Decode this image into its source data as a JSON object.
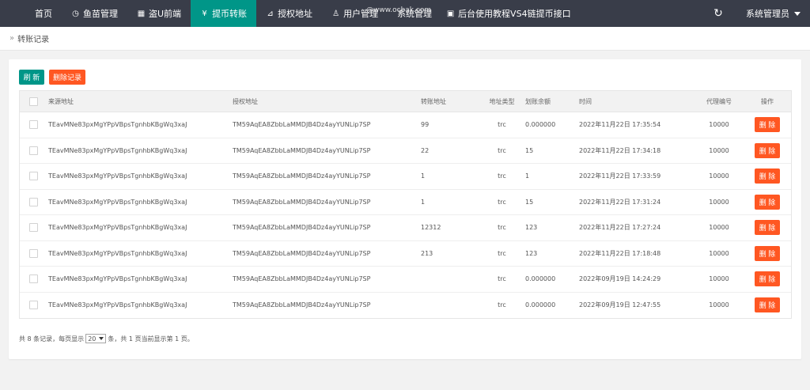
{
  "nav": {
    "home": "首页",
    "items": [
      {
        "label": "鱼苗管理",
        "icon": "clock-icon"
      },
      {
        "label": "盗U前端",
        "icon": "windows-icon"
      },
      {
        "label": "提币转账",
        "icon": "yen-circle-icon"
      },
      {
        "label": "授权地址",
        "icon": "rss-icon"
      },
      {
        "label": "用户管理",
        "icon": "user-icon"
      },
      {
        "label": "系统管理",
        "icon": ""
      },
      {
        "label": "后台使用教程VS4链提币接口",
        "icon": "book-icon"
      }
    ],
    "watermark": "@www.ocbak.com",
    "admin": "系统管理员"
  },
  "breadcrumb": {
    "current": "转账记录"
  },
  "toolbar": {
    "refresh": "刷 新",
    "delete_records": "删除记录"
  },
  "table": {
    "headers": [
      "来源地址",
      "授权地址",
      "转账地址",
      "地址类型",
      "划账余额",
      "时间",
      "代理编号",
      "操作"
    ],
    "delete_label": "删 除",
    "rows": [
      {
        "src": "TEavMNe83pxMgYPpVBpsTgnhbKBgWq3xaJ",
        "auth": "TM59AqEA8ZbbLaMMDJB4Dz4ayYUNLip7SP",
        "addr": "99",
        "type": "trc",
        "bal": "0.000000",
        "time": "2022年11月22日 17:35:54",
        "agent": "10000"
      },
      {
        "src": "TEavMNe83pxMgYPpVBpsTgnhbKBgWq3xaJ",
        "auth": "TM59AqEA8ZbbLaMMDJB4Dz4ayYUNLip7SP",
        "addr": "22",
        "type": "trc",
        "bal": "15",
        "time": "2022年11月22日 17:34:18",
        "agent": "10000"
      },
      {
        "src": "TEavMNe83pxMgYPpVBpsTgnhbKBgWq3xaJ",
        "auth": "TM59AqEA8ZbbLaMMDJB4Dz4ayYUNLip7SP",
        "addr": "1",
        "type": "trc",
        "bal": "1",
        "time": "2022年11月22日 17:33:59",
        "agent": "10000"
      },
      {
        "src": "TEavMNe83pxMgYPpVBpsTgnhbKBgWq3xaJ",
        "auth": "TM59AqEA8ZbbLaMMDJB4Dz4ayYUNLip7SP",
        "addr": "1",
        "type": "trc",
        "bal": "15",
        "time": "2022年11月22日 17:31:24",
        "agent": "10000"
      },
      {
        "src": "TEavMNe83pxMgYPpVBpsTgnhbKBgWq3xaJ",
        "auth": "TM59AqEA8ZbbLaMMDJB4Dz4ayYUNLip7SP",
        "addr": "12312",
        "type": "trc",
        "bal": "123",
        "time": "2022年11月22日 17:27:24",
        "agent": "10000"
      },
      {
        "src": "TEavMNe83pxMgYPpVBpsTgnhbKBgWq3xaJ",
        "auth": "TM59AqEA8ZbbLaMMDJB4Dz4ayYUNLip7SP",
        "addr": "213",
        "type": "trc",
        "bal": "123",
        "time": "2022年11月22日 17:18:48",
        "agent": "10000"
      },
      {
        "src": "TEavMNe83pxMgYPpVBpsTgnhbKBgWq3xaJ",
        "auth": "TM59AqEA8ZbbLaMMDJB4Dz4ayYUNLip7SP",
        "addr": "",
        "type": "trc",
        "bal": "0.000000",
        "time": "2022年09月19日 14:24:29",
        "agent": "10000"
      },
      {
        "src": "TEavMNe83pxMgYPpVBpsTgnhbKBgWq3xaJ",
        "auth": "TM59AqEA8ZbbLaMMDJB4Dz4ayYUNLip7SP",
        "addr": "",
        "type": "trc",
        "bal": "0.000000",
        "time": "2022年09月19日 12:47:55",
        "agent": "10000"
      }
    ]
  },
  "pager": {
    "prefix": "共 8 条记录，每页显示",
    "page_size": "20",
    "suffix": "条，共 1 页当前显示第 1 页。"
  },
  "colors": {
    "nav_bg": "#393d49",
    "active": "#009688",
    "danger": "#ff5722"
  }
}
